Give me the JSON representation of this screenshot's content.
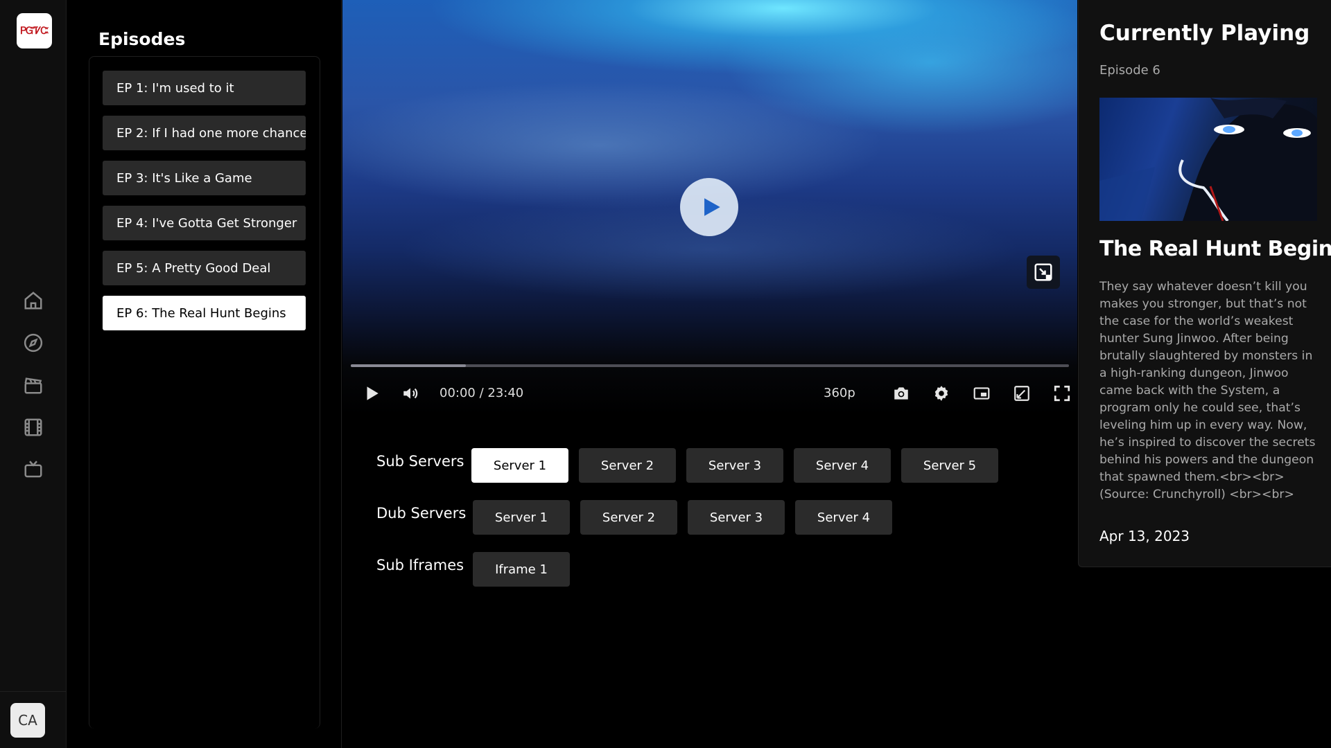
{
  "rail": {
    "logo_text": "ᏢᏳᏤᏨ",
    "nav_icons": [
      "home-icon",
      "compass-icon",
      "clapperboard-icon",
      "film-icon",
      "tv-icon"
    ],
    "lang_label": "CA"
  },
  "episodes": {
    "title": "Episodes",
    "items": [
      {
        "label": "EP 1: I'm used to it"
      },
      {
        "label": "EP 2: If I had one more chance"
      },
      {
        "label": "EP 3: It's Like a Game"
      },
      {
        "label": "EP 4: I've Gotta Get Stronger"
      },
      {
        "label": "EP 5: A Pretty Good Deal"
      },
      {
        "label": "EP 6: The Real Hunt Begins"
      }
    ],
    "active_index": 5
  },
  "player": {
    "time": "00:00 / 23:40",
    "quality": "360p",
    "buffered_fraction": 0.16
  },
  "servers": {
    "sub_label": "Sub Servers",
    "sub": [
      "Server 1",
      "Server 2",
      "Server 3",
      "Server 4",
      "Server 5"
    ],
    "dub_label": "Dub Servers",
    "dub": [
      "Server 1",
      "Server 2",
      "Server 3",
      "Server 4"
    ],
    "iframe_label": "Sub Iframes",
    "iframes": [
      "Iframe 1"
    ]
  },
  "info": {
    "heading": "Currently Playing",
    "episode": "Episode 6",
    "title": "The Real Hunt Begins",
    "description": "They say whatever doesn’t kill you makes you stronger, but that’s not the case for the world’s weakest hunter Sung Jinwoo. After being brutally slaughtered by monsters in a high-ranking dungeon, Jinwoo came back with the System, a program only he could see, that’s leveling him up in every way. Now, he’s inspired to discover the secrets behind his powers and the dungeon that spawned them.<br><br> (Source: Crunchyroll) <br><br>",
    "date": "Apr 13, 2023"
  },
  "colors": {
    "background": "#000000",
    "panel": "#111111",
    "button": "#2b2b2b",
    "active": "#ffffff"
  }
}
